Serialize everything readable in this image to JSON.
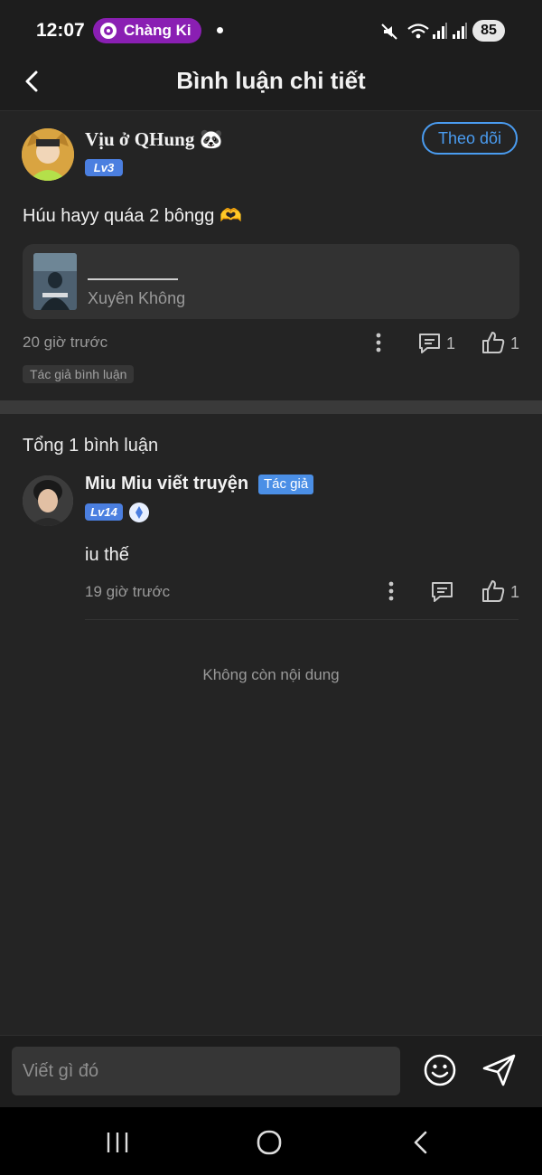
{
  "status_bar": {
    "time": "12:07",
    "notification_pill": "Chàng Ki",
    "battery": "85"
  },
  "header": {
    "title": "Bình luận chi tiết"
  },
  "post": {
    "author": "Vịu ở QHung 🐼",
    "level": "Lv3",
    "follow_label": "Theo dõi",
    "text": "Húu hayy quáa 2 bôngg 🫶",
    "book": {
      "title_line": "__________",
      "name": "Xuyên Không"
    },
    "time": "20 giờ trước",
    "comment_count": "1",
    "like_count": "1",
    "tag": "Tác giả bình luận"
  },
  "comments": {
    "total": "Tổng 1 bình luận",
    "items": [
      {
        "author": "Miu Miu viết truyện",
        "author_tag": "Tác giả",
        "level": "Lv14",
        "text": "iu thế",
        "time": "19 giờ trước",
        "like_count": "1"
      }
    ],
    "end_text": "Không còn nội dung"
  },
  "composer": {
    "placeholder": "Viết gì đó"
  },
  "colors": {
    "background": "#242424",
    "accent": "#4a9cf0",
    "level_badge": "#4b7fe0",
    "pill": "#8a1fb3"
  }
}
